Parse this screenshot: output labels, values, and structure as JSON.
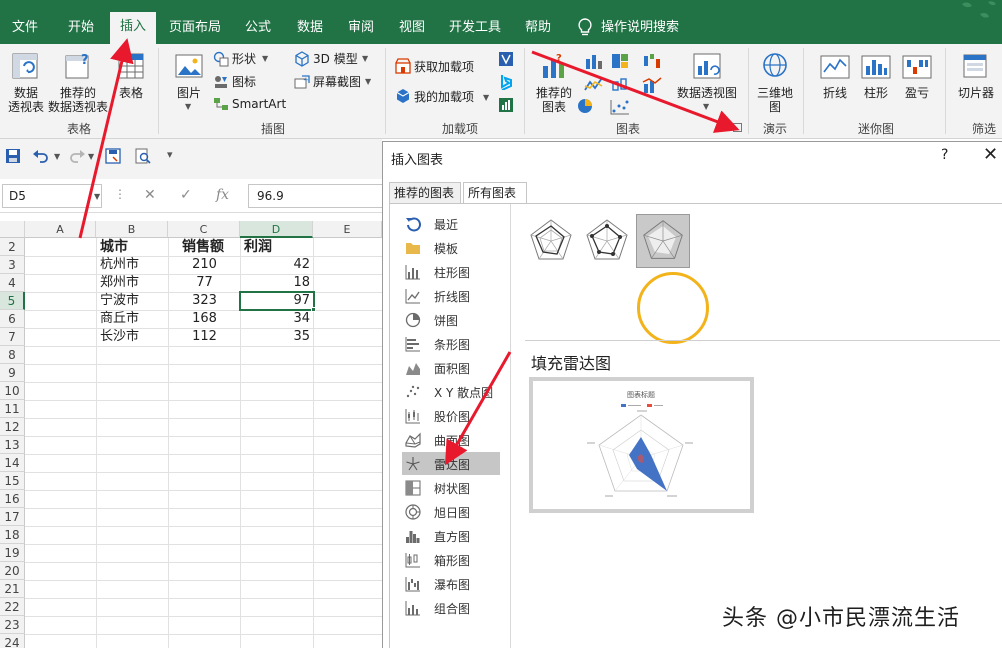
{
  "tabs": [
    "文件",
    "开始",
    "插入",
    "页面布局",
    "公式",
    "数据",
    "审阅",
    "视图",
    "开发工具",
    "帮助",
    "操作说明搜索"
  ],
  "active_tab": "插入",
  "ribbon": {
    "tables": {
      "pivot": [
        "数据",
        "透视表"
      ],
      "recommended_pivot": [
        "推荐的",
        "数据透视表"
      ],
      "table": "表格",
      "group": "表格"
    },
    "illustrations": {
      "pictures": "图片",
      "shapes": "形状",
      "icons": "图标",
      "smartart": "SmartArt",
      "model3d": "3D 模型",
      "screenshot": "屏幕截图",
      "group": "插图"
    },
    "addins": {
      "get": "获取加载项",
      "my": "我的加载项",
      "group": "加载项"
    },
    "charts": {
      "recommended": [
        "推荐的",
        "图表"
      ],
      "pivot_chart": "数据透视图",
      "group": "图表"
    },
    "tours": {
      "map3d": [
        "三维地",
        "图"
      ],
      "group": "演示"
    },
    "sparklines": {
      "line": "折线",
      "column": "柱形",
      "winloss": "盈亏",
      "group": "迷你图"
    },
    "filters": {
      "slicer": "切片器",
      "group": "筛选"
    }
  },
  "formula_bar": {
    "namebox": "D5",
    "value": "96.9",
    "fx": "fx"
  },
  "sheet": {
    "columns": [
      "A",
      "B",
      "C",
      "D",
      "E"
    ],
    "rows": [
      "2",
      "3",
      "4",
      "5",
      "6",
      "7",
      "8",
      "9",
      "10",
      "11",
      "12",
      "13",
      "14",
      "15",
      "16",
      "17",
      "18",
      "19",
      "20",
      "21",
      "22",
      "23",
      "24"
    ],
    "header": [
      "城市",
      "销售额",
      "利润"
    ],
    "data": [
      [
        "杭州市",
        "210",
        "42"
      ],
      [
        "郑州市",
        "77",
        "18"
      ],
      [
        "宁波市",
        "323",
        "97"
      ],
      [
        "商丘市",
        "168",
        "34"
      ],
      [
        "长沙市",
        "112",
        "35"
      ]
    ],
    "selected_cell": "D5"
  },
  "dialog": {
    "title": "插入图表",
    "help": "?",
    "close": "✕",
    "tabs": [
      "推荐的图表",
      "所有图表"
    ],
    "active_tab": "所有图表",
    "types": [
      "最近",
      "模板",
      "柱形图",
      "折线图",
      "饼图",
      "条形图",
      "面积图",
      "X Y 散点图",
      "股价图",
      "曲面图",
      "雷达图",
      "树状图",
      "旭日图",
      "直方图",
      "箱形图",
      "瀑布图",
      "组合图"
    ],
    "selected_type": "雷达图",
    "selected_subtype_name": "填充雷达图",
    "preview": {
      "title": "图表标题"
    }
  },
  "watermark": "头条 @小市民漂流生活",
  "colors": {
    "excel_green": "#217346",
    "highlight": "#f2b31b",
    "arrow": "#e8192c",
    "radar_fill": "#4472c4"
  }
}
